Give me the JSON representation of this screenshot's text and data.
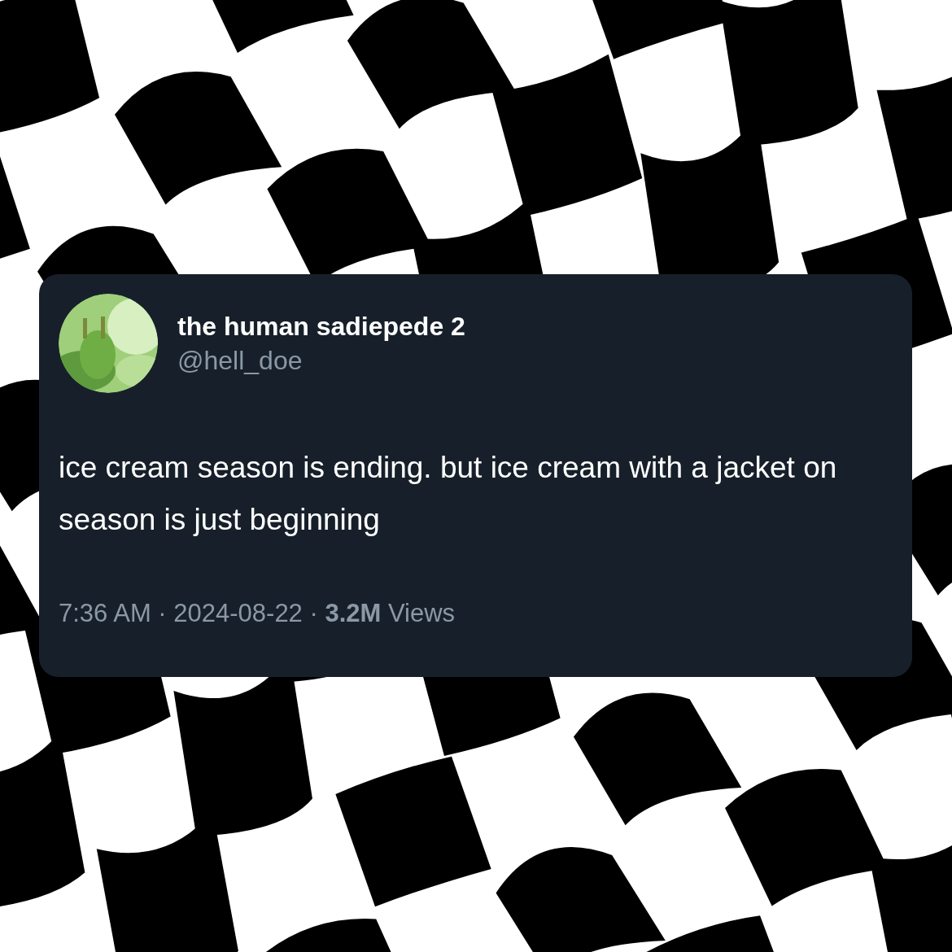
{
  "post": {
    "author": {
      "name": "the human sadiepede 2",
      "handle": "@hell_doe"
    },
    "text": "ice cream season is ending. but ice cream with a jacket on season is just beginning",
    "meta": "7:36 AM · 2024-08-22 · **3.2M** Views"
  }
}
